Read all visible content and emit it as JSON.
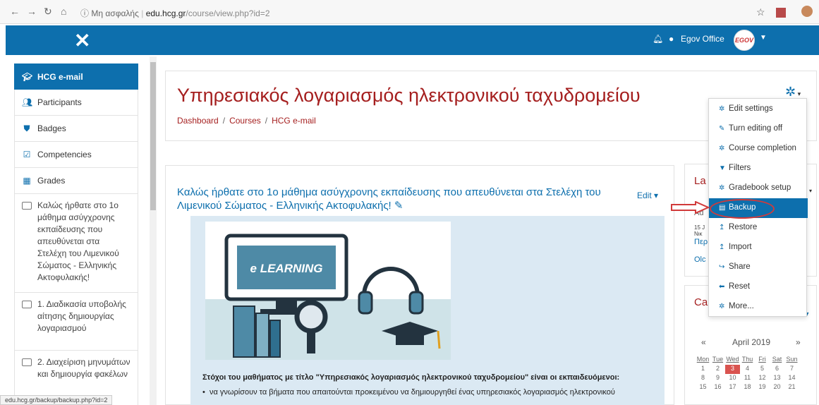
{
  "browser": {
    "security_label": "Μη ασφαλής",
    "host": "edu.hcg.gr",
    "path": "/course/view.php?id=2"
  },
  "topbar": {
    "close_glyph": "✕",
    "user_name": "Egov Office",
    "logo_text": "EGOV"
  },
  "sidebar": {
    "items": [
      {
        "label": "HCG e-mail",
        "icon": "graduation-cap-icon"
      },
      {
        "label": "Participants",
        "icon": "users-icon"
      },
      {
        "label": "Badges",
        "icon": "shield-icon"
      },
      {
        "label": "Competencies",
        "icon": "checkbox-icon"
      },
      {
        "label": "Grades",
        "icon": "table-icon"
      }
    ],
    "sections": [
      "Καλώς ήρθατε στο 1ο μάθημα ασύγχρονης εκπαίδευσης που απευθύνεται στα Στελέχη του Λιμενικού Σώματος - Ελληνικής Ακτοφυλακής!",
      "1. Διαδικασία υποβολής αίτησης δημιουργίας λογαριασμού",
      "2. Διαχείριση μηνυμάτων και δημιουργία φακέλων"
    ]
  },
  "course": {
    "title": "Υπηρεσιακός λογαριασμός ηλεκτρονικού ταχυδρομείου",
    "breadcrumb": [
      "Dashboard",
      "Courses",
      "HCG e-mail"
    ],
    "welcome": "Καλώς ήρθατε στο 1ο μάθημα ασύγχρονης εκπαίδευσης που απευθύνεται στα Στελέχη του Λιμενικού Σώματος - Ελληνικής Ακτοφυλακής!",
    "edit_label": "Edit",
    "image_caption": "e LEARNING",
    "goals_heading": "Στόχοι του μαθήματος με τίτλο \"Υπηρεσιακός λογαριασμός ηλεκτρονικού ταχυδρομείου\" είναι οι εκπαιδευόμενοι:",
    "goal_item": "να γνωρίσουν τα βήματα που απαιτούνται προκειμένου να δημιουργηθεί ένας υπηρεσιακός λογαριασμός ηλεκτρονικού"
  },
  "right_blocks": {
    "latest_title": "La",
    "latest_lines": [
      "Ad",
      "15 J",
      "Νικ",
      "Περ",
      "Olc"
    ],
    "calendar_title": "Ca",
    "calendar": {
      "month": "April 2019",
      "prev": "«",
      "next": "»",
      "weekdays": [
        "Mon",
        "Tue",
        "Wed",
        "Thu",
        "Fri",
        "Sat",
        "Sun"
      ],
      "rows": [
        [
          "1",
          "2",
          "3",
          "4",
          "5",
          "6",
          "7"
        ],
        [
          "8",
          "9",
          "10",
          "11",
          "12",
          "13",
          "14"
        ],
        [
          "15",
          "16",
          "17",
          "18",
          "19",
          "20",
          "21"
        ]
      ],
      "today": "3"
    }
  },
  "menu": {
    "items": [
      {
        "label": "Edit settings",
        "icon": "gear-icon"
      },
      {
        "label": "Turn editing off",
        "icon": "pencil-icon"
      },
      {
        "label": "Course completion",
        "icon": "gear-icon"
      },
      {
        "label": "Filters",
        "icon": "filter-icon"
      },
      {
        "label": "Gradebook setup",
        "icon": "gear-icon"
      },
      {
        "label": "Backup",
        "icon": "file-icon"
      },
      {
        "label": "Restore",
        "icon": "upload-icon"
      },
      {
        "label": "Import",
        "icon": "upload-icon"
      },
      {
        "label": "Share",
        "icon": "share-icon"
      },
      {
        "label": "Reset",
        "icon": "arrow-left-icon"
      },
      {
        "label": "More...",
        "icon": "gear-icon"
      }
    ],
    "highlighted": "Backup"
  },
  "status_bar": "edu.hcg.gr/backup/backup.php?id=2",
  "colors": {
    "brand": "#0d6fad",
    "title": "#a51f1f",
    "annotation": "#d13a3a"
  }
}
